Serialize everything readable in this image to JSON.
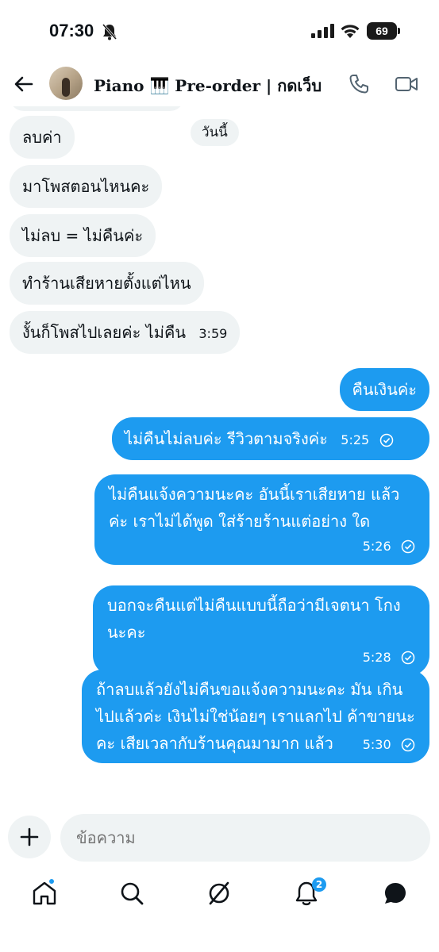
{
  "status": {
    "time": "07:30",
    "battery": "69"
  },
  "header": {
    "title": "Piano 🎹 Pre-order | กดเว็บ"
  },
  "chat": {
    "date_label": "วันนี้",
    "incoming": [
      {
        "text": "ลบค่า"
      },
      {
        "text": "มาโพสตอนไหนคะ"
      },
      {
        "text": "ไม่ลบ = ไม่คืนค่ะ"
      },
      {
        "text": "ทำร้านเสียหายตั้งแต่ไหน"
      },
      {
        "text": "งั้นก็โพสไปเลยค่ะ ไม่คืน",
        "time": "3:59"
      }
    ],
    "outgoing": [
      {
        "text": "คืนเงินค่ะ"
      },
      {
        "text": "ไม่คืนไม่ลบค่ะ รีวิวตามจริงค่ะ",
        "time": "5:25"
      },
      {
        "text": "ไม่คืนแจ้งความนะคะ อันนี้เราเสียหาย แล้วค่ะ เราไม่ได้พูด ใส่ร้ายร้านแต่อย่าง ใด",
        "time": "5:26"
      },
      {
        "text": "บอกจะคืนแต่ไม่คืนแบบนี้ถือว่ามีเจตนา โกงนะคะ",
        "time": "5:28"
      },
      {
        "text": "ถ้าลบแล้วยังไม่คืนขอแจ้งความนะคะ มัน เกินไปแล้วค่ะ เงินไม่ใช่น้อยๆ เราแลกไป ค้าขายนะคะ เสียเวลากับร้านคุณมามาก แล้ว",
        "time": "5:30"
      }
    ]
  },
  "composer": {
    "placeholder": "ข้อความ"
  },
  "nav": {
    "notifications_count": "2"
  },
  "colors": {
    "accent": "#1d9bf0",
    "bubble_in": "#eff3f4",
    "text": "#0f1419"
  }
}
